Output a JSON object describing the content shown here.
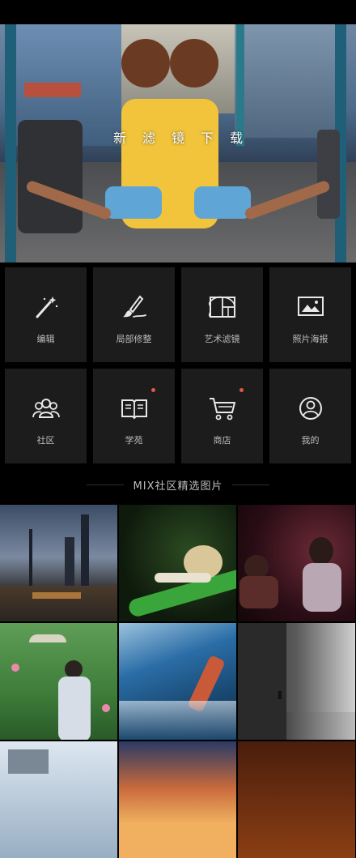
{
  "hero": {
    "banner_text": "新滤镜下载"
  },
  "tools": [
    {
      "label": "编辑",
      "icon": "magic-wand-icon",
      "badge": false
    },
    {
      "label": "局部修整",
      "icon": "brush-icon",
      "badge": false
    },
    {
      "label": "艺术滤镜",
      "icon": "golden-ratio-icon",
      "badge": false
    },
    {
      "label": "照片海报",
      "icon": "poster-icon",
      "badge": false
    },
    {
      "label": "社区",
      "icon": "community-icon",
      "badge": false
    },
    {
      "label": "学苑",
      "icon": "book-icon",
      "badge": true
    },
    {
      "label": "商店",
      "icon": "cart-icon",
      "badge": true
    },
    {
      "label": "我的",
      "icon": "user-icon",
      "badge": false
    }
  ],
  "gallery": {
    "title": "MIX社区精选图片",
    "photos": [
      {
        "subject": "city-skyline"
      },
      {
        "subject": "snail-on-leaf"
      },
      {
        "subject": "concert-singer"
      },
      {
        "subject": "lotus-girl-umbrella"
      },
      {
        "subject": "ocean-waves-bottle"
      },
      {
        "subject": "concrete-corridor"
      },
      {
        "subject": "building-sky"
      },
      {
        "subject": "sunset-clouds"
      },
      {
        "subject": "autumn-foliage"
      }
    ]
  },
  "colors": {
    "background": "#000000",
    "tile": "#1c1c1c",
    "badge": "#e0564a"
  }
}
